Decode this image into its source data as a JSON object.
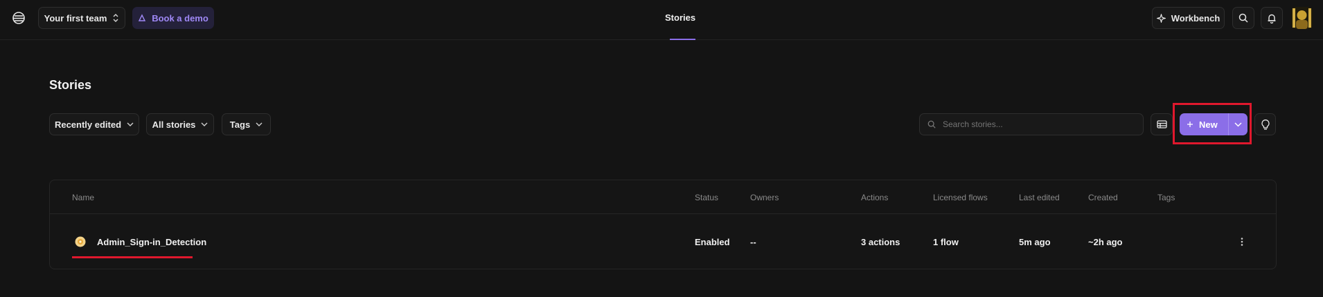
{
  "topbar": {
    "team_label": "Your first team",
    "book_demo_label": "Book a demo",
    "center_tab": "Stories",
    "workbench_label": "Workbench"
  },
  "page": {
    "title": "Stories"
  },
  "filters": {
    "sort_label": "Recently edited",
    "scope_label": "All stories",
    "tags_label": "Tags"
  },
  "search": {
    "placeholder": "Search stories..."
  },
  "new_button": {
    "label": "New"
  },
  "table": {
    "columns": [
      "Name",
      "Status",
      "Owners",
      "Actions",
      "Licensed flows",
      "Last edited",
      "Created",
      "Tags"
    ],
    "rows": [
      {
        "name": "Admin_Sign-in_Detection",
        "status": "Enabled",
        "owners": "--",
        "actions": "3 actions",
        "licensed_flows": "1 flow",
        "last_edited": "5m ago",
        "created": "~2h ago",
        "tags": ""
      }
    ]
  },
  "colors": {
    "accent": "#8b6ee8",
    "highlight": "#e0182d",
    "background": "#141414"
  }
}
